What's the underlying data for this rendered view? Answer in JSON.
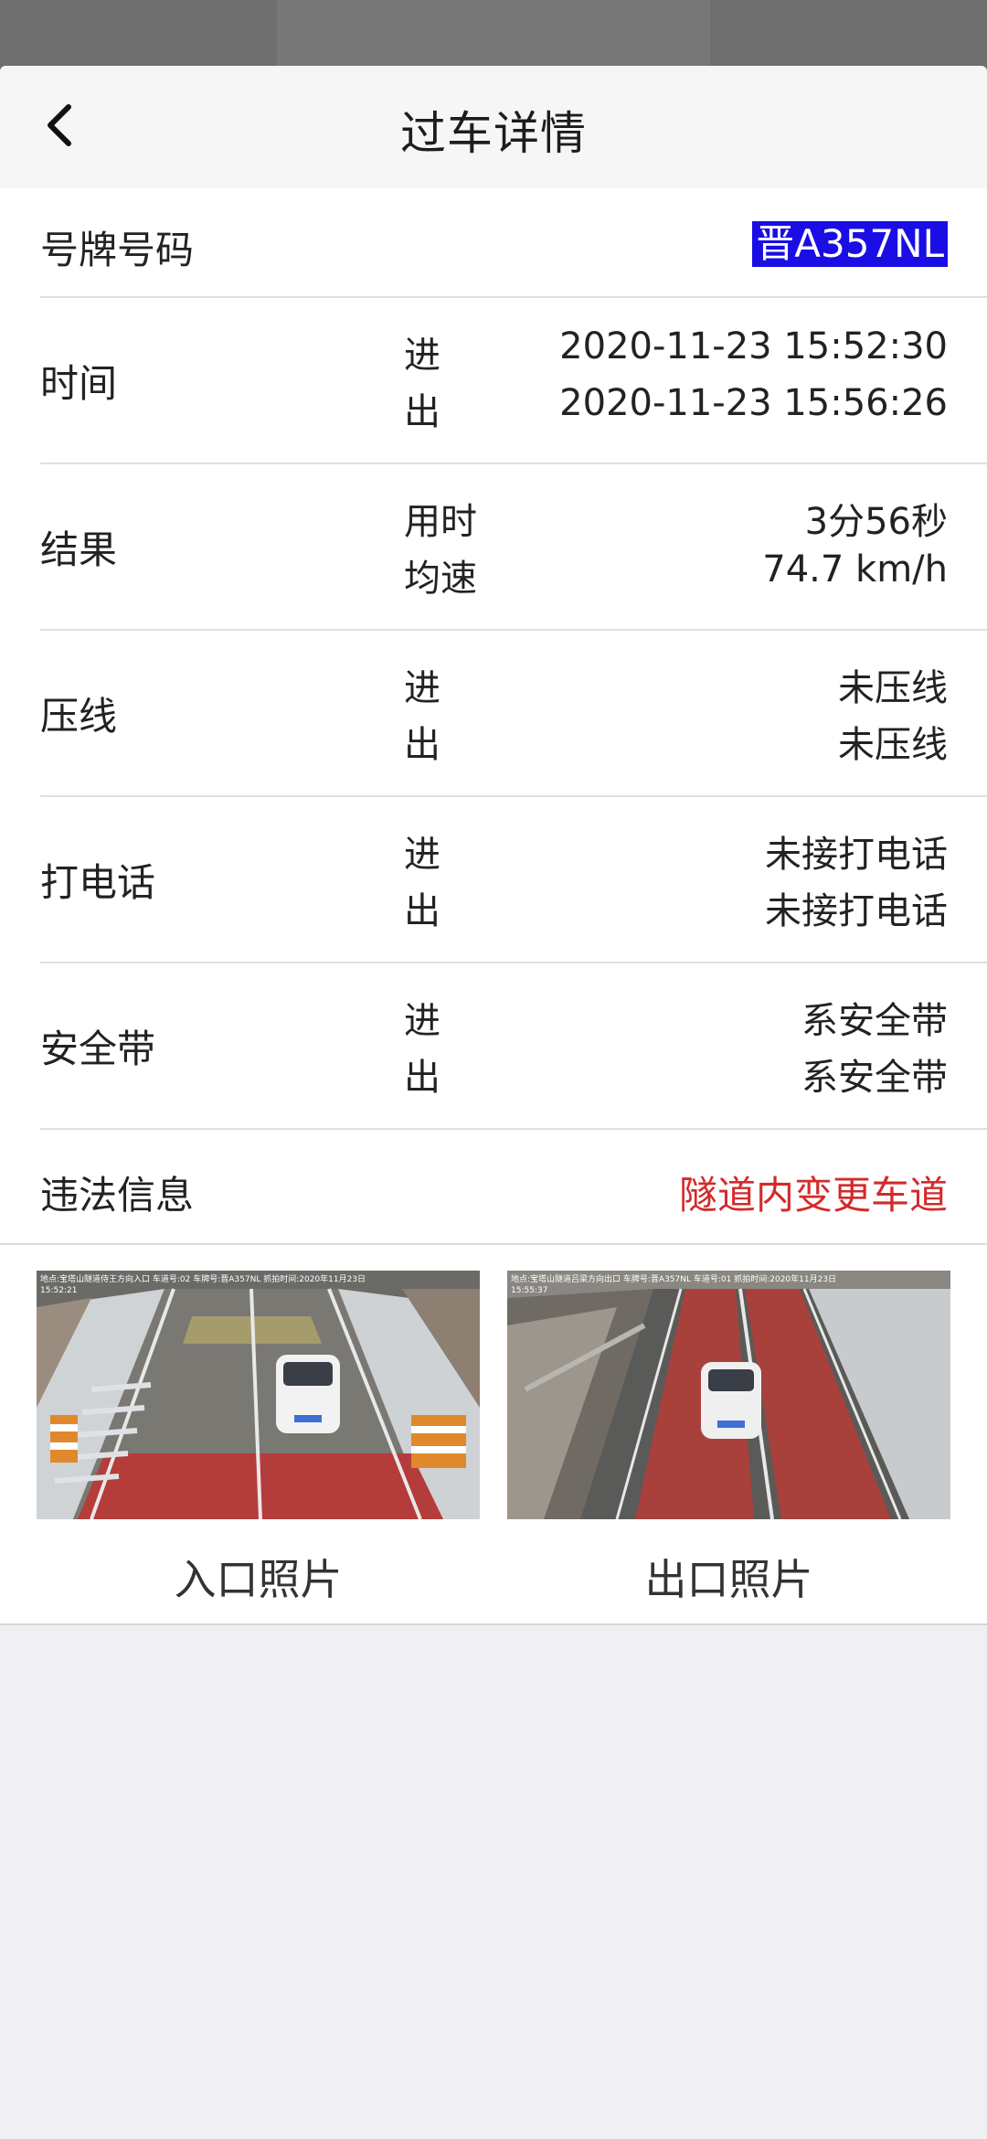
{
  "header": {
    "title": "过车详情"
  },
  "plate": {
    "label": "号牌号码",
    "value": "晋A357NL"
  },
  "rows": [
    {
      "label": "时间",
      "sub1": "进",
      "val1": "2020-11-23 15:52:30",
      "sub2": "出",
      "val2": "2020-11-23 15:56:26"
    },
    {
      "label": "结果",
      "sub1": "用时",
      "val1": "3分56秒",
      "sub2": "均速",
      "val2": "74.7 km/h"
    },
    {
      "label": "压线",
      "sub1": "进",
      "val1": "未压线",
      "sub2": "出",
      "val2": "未压线"
    },
    {
      "label": "打电话",
      "sub1": "进",
      "val1": "未接打电话",
      "sub2": "出",
      "val2": "未接打电话"
    },
    {
      "label": "安全带",
      "sub1": "进",
      "val1": "系安全带",
      "sub2": "出",
      "val2": "系安全带"
    }
  ],
  "violation": {
    "label": "违法信息",
    "value": "隧道内变更车道",
    "color": "#d42a2a"
  },
  "photos": {
    "entry_caption": "入口照片",
    "exit_caption": "出口照片",
    "entry_overlay_line1": "地点:宝塔山隧道侍王方向入口 车道号:02 车牌号:晋A357NL 抓拍时间:2020年11月23日",
    "entry_overlay_line2": "15:52:21",
    "exit_overlay_line1": "地点:宝塔山隧道吕梁方向出口 车牌号:晋A357NL 车道号:01 抓拍时间:2020年11月23日",
    "exit_overlay_line2": "15:55:37"
  },
  "colors": {
    "plate_highlight": "#1a0ee5",
    "accent_red": "#d42a2a"
  }
}
